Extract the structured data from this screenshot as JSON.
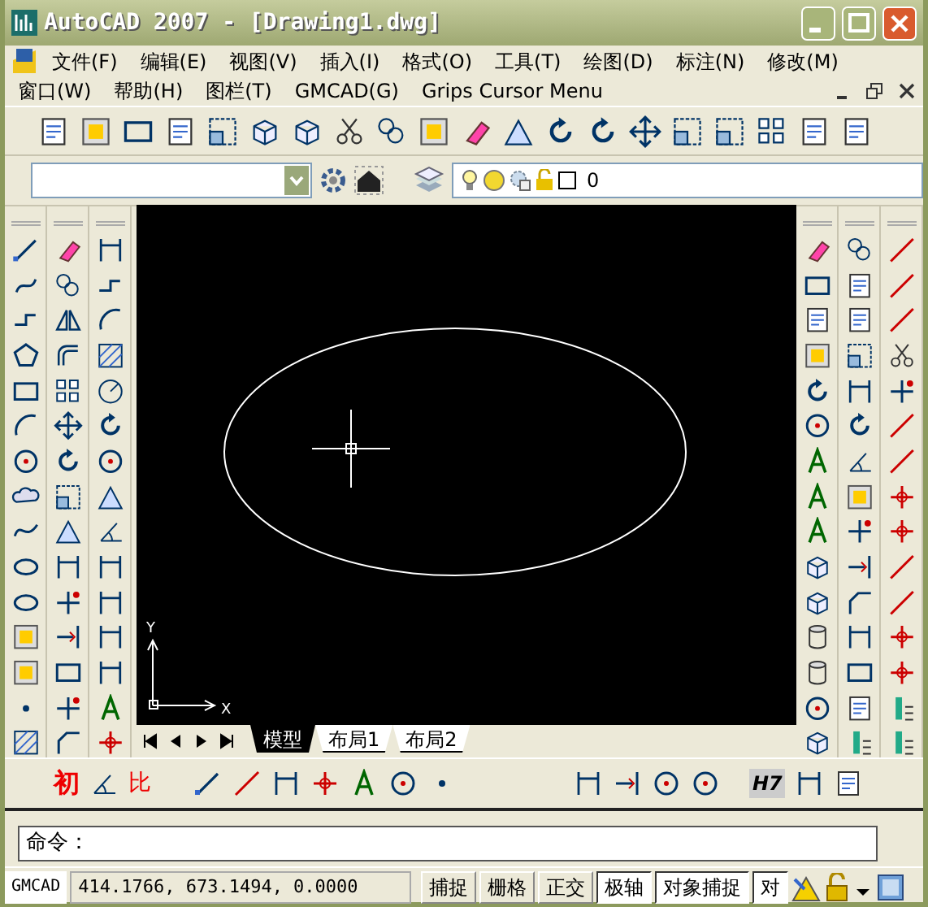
{
  "window": {
    "title": "AutoCAD 2007 - [Drawing1.dwg]"
  },
  "menu_bar": [
    {
      "label": "文件(F)"
    },
    {
      "label": "编辑(E)"
    },
    {
      "label": "视图(V)"
    },
    {
      "label": "插入(I)"
    },
    {
      "label": "格式(O)"
    },
    {
      "label": "工具(T)"
    },
    {
      "label": "绘图(D)"
    },
    {
      "label": "标注(N)"
    },
    {
      "label": "修改(M)"
    }
  ],
  "menu_bar_2": [
    {
      "label": "窗口(W)"
    },
    {
      "label": "帮助(H)"
    },
    {
      "label": "图栏(T)"
    },
    {
      "label": "GMCAD(G)"
    },
    {
      "label": "Grips Cursor Menu"
    }
  ],
  "layer_bar": {
    "layer_name": "0"
  },
  "ucs_axes": {
    "y_label": "Y",
    "x_label": "X"
  },
  "layout_tabs": [
    {
      "label": "模型",
      "selected": true
    },
    {
      "label": "布局1",
      "selected": false
    },
    {
      "label": "布局2",
      "selected": false
    }
  ],
  "bottom_toolbar": {
    "left_glyphs": [
      "初",
      "比"
    ],
    "right_glyph": "H7"
  },
  "command_line": {
    "prompt": "命令："
  },
  "status_bar": {
    "app": "GMCAD",
    "coordinates": "414.1766, 673.1494, 0.0000",
    "toggles": [
      {
        "label": "捕捉",
        "on": false
      },
      {
        "label": "栅格",
        "on": false
      },
      {
        "label": "正交",
        "on": false
      },
      {
        "label": "极轴",
        "on": true
      },
      {
        "label": "对象捕捉",
        "on": true
      },
      {
        "label": "对",
        "on": true
      }
    ]
  }
}
